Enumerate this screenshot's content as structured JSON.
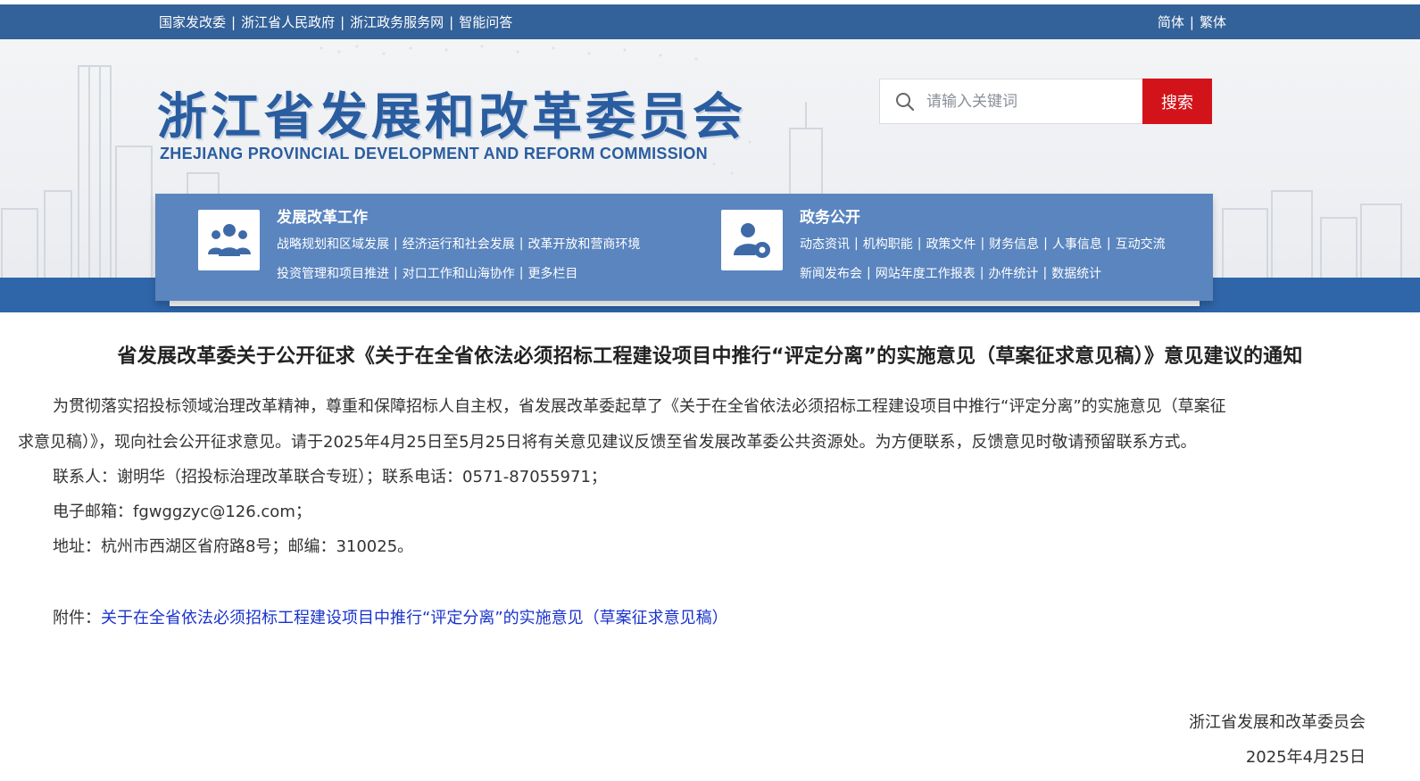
{
  "topbar": {
    "links": [
      "国家发改委",
      "浙江省人民政府",
      "浙江政务服务网",
      "智能问答"
    ],
    "separator": "|",
    "lang": [
      "简体",
      "繁体"
    ]
  },
  "header": {
    "logo_cn": "浙江省发展和改革委员会",
    "logo_en": "ZHEJIANG PROVINCIAL DEVELOPMENT AND REFORM COMMISSION"
  },
  "search": {
    "placeholder": "请输入关键词",
    "button_label": "搜索"
  },
  "nav": {
    "groups": [
      {
        "title": "发展改革工作",
        "icon": "people-group-icon",
        "lines": [
          [
            "战略规划和区域发展",
            "经济运行和社会发展",
            "改革开放和营商环境"
          ],
          [
            "投资管理和项目推进",
            "对口工作和山海协作",
            "更多栏目"
          ]
        ]
      },
      {
        "title": "政务公开",
        "icon": "user-gear-icon",
        "lines": [
          [
            "动态资讯",
            "机构职能",
            "政策文件",
            "财务信息",
            "人事信息",
            "互动交流"
          ],
          [
            "新闻发布会",
            "网站年度工作报表",
            "办件统计",
            "数据统计"
          ]
        ]
      }
    ]
  },
  "article": {
    "title": "省发展改革委关于公开征求《关于在全省依法必须招标工程建设项目中推行“评定分离”的实施意见（草案征求意见稿）》意见建议的通知",
    "para1_line1": "为贯彻落实招投标领域治理改革精神，尊重和保障招标人自主权，省发展改革委起草了《关于在全省依法必须招标工程建设项目中推行“评定分离”的实施意见（草案征",
    "para1_line2": "求意见稿）》，现向社会公开征求意见。请于2025年4月25日至5月25日将有关意见建议反馈至省发展改革委公共资源处。为方便联系，反馈意见时敬请预留联系方式。",
    "contact": "联系人：谢明华（招投标治理改革联合专班）；联系电话：0571-87055971；",
    "email": "电子邮箱：fgwggzyc@126.com；",
    "address": "地址：杭州市西湖区省府路8号；邮编：310025。",
    "attachment_label": "附件：",
    "attachment_link": "关于在全省依法必须招标工程建设项目中推行“评定分离”的实施意见（草案征求意见稿）",
    "signature": "浙江省发展和改革委员会",
    "date": "2025年4月25日"
  },
  "colors": {
    "topbar": "#336199",
    "nav_panel": "#5a85bf",
    "search_button": "#d2141a",
    "logo": "#2a5d9f",
    "link": "#1a33cc"
  }
}
